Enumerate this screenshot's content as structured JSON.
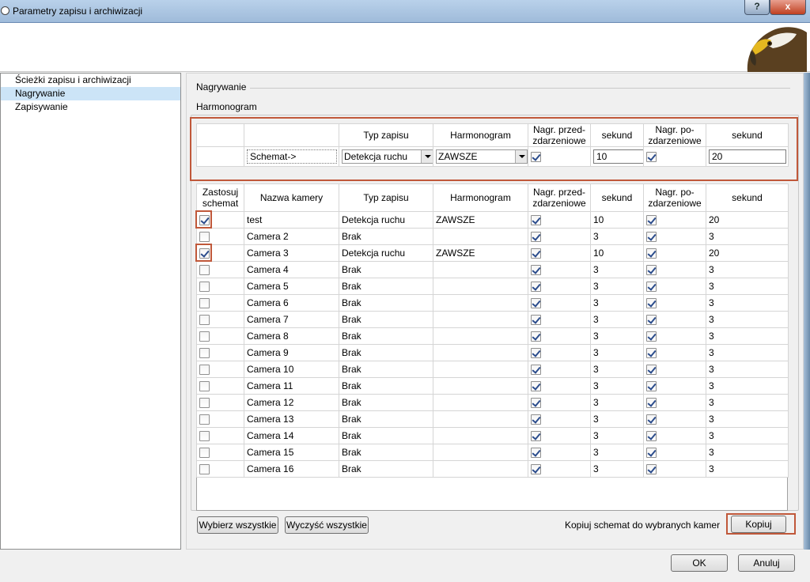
{
  "window": {
    "title": "Parametry zapisu i archiwizacji",
    "help_label": "?",
    "close_label": "x"
  },
  "sidebar": {
    "items": [
      {
        "label": "Ścieżki zapisu i archiwizacji"
      },
      {
        "label": "Nagrywanie"
      },
      {
        "label": "Zapisywanie"
      }
    ]
  },
  "section": {
    "title": "Nagrywanie",
    "subtitle": "Harmonogram"
  },
  "schema_table": {
    "headers": [
      "",
      "",
      "Typ zapisu",
      "Harmonogram",
      "Nagr. przed-\nzdarzeniowe",
      "sekund",
      "Nagr. po-\nzdarzeniowe",
      "sekund"
    ],
    "row": {
      "label": "Schemat->",
      "type": "Detekcja ruchu",
      "schedule": "ZAWSZE",
      "pre_checked": true,
      "pre_seconds": "10",
      "post_checked": true,
      "post_seconds": "20"
    }
  },
  "camera_table": {
    "headers": [
      "Zastosuj\nschemat",
      "Nazwa kamery",
      "Typ zapisu",
      "Harmonogram",
      "Nagr. przed-\nzdarzeniowe",
      "sekund",
      "Nagr. po-\nzdarzeniowe",
      "sekund"
    ],
    "rows": [
      {
        "apply": true,
        "name": "test",
        "type": "Detekcja ruchu",
        "schedule": "ZAWSZE",
        "pre": true,
        "pre_s": "10",
        "post": true,
        "post_s": "20"
      },
      {
        "apply": false,
        "name": "Camera 2",
        "type": "Brak",
        "schedule": "",
        "pre": true,
        "pre_s": "3",
        "post": true,
        "post_s": "3"
      },
      {
        "apply": true,
        "name": "Camera 3",
        "type": "Detekcja ruchu",
        "schedule": "ZAWSZE",
        "pre": true,
        "pre_s": "10",
        "post": true,
        "post_s": "20"
      },
      {
        "apply": false,
        "name": "Camera 4",
        "type": "Brak",
        "schedule": "",
        "pre": true,
        "pre_s": "3",
        "post": true,
        "post_s": "3"
      },
      {
        "apply": false,
        "name": "Camera 5",
        "type": "Brak",
        "schedule": "",
        "pre": true,
        "pre_s": "3",
        "post": true,
        "post_s": "3"
      },
      {
        "apply": false,
        "name": "Camera 6",
        "type": "Brak",
        "schedule": "",
        "pre": true,
        "pre_s": "3",
        "post": true,
        "post_s": "3"
      },
      {
        "apply": false,
        "name": "Camera 7",
        "type": "Brak",
        "schedule": "",
        "pre": true,
        "pre_s": "3",
        "post": true,
        "post_s": "3"
      },
      {
        "apply": false,
        "name": "Camera 8",
        "type": "Brak",
        "schedule": "",
        "pre": true,
        "pre_s": "3",
        "post": true,
        "post_s": "3"
      },
      {
        "apply": false,
        "name": "Camera 9",
        "type": "Brak",
        "schedule": "",
        "pre": true,
        "pre_s": "3",
        "post": true,
        "post_s": "3"
      },
      {
        "apply": false,
        "name": "Camera 10",
        "type": "Brak",
        "schedule": "",
        "pre": true,
        "pre_s": "3",
        "post": true,
        "post_s": "3"
      },
      {
        "apply": false,
        "name": "Camera 11",
        "type": "Brak",
        "schedule": "",
        "pre": true,
        "pre_s": "3",
        "post": true,
        "post_s": "3"
      },
      {
        "apply": false,
        "name": "Camera 12",
        "type": "Brak",
        "schedule": "",
        "pre": true,
        "pre_s": "3",
        "post": true,
        "post_s": "3"
      },
      {
        "apply": false,
        "name": "Camera 13",
        "type": "Brak",
        "schedule": "",
        "pre": true,
        "pre_s": "3",
        "post": true,
        "post_s": "3"
      },
      {
        "apply": false,
        "name": "Camera 14",
        "type": "Brak",
        "schedule": "",
        "pre": true,
        "pre_s": "3",
        "post": true,
        "post_s": "3"
      },
      {
        "apply": false,
        "name": "Camera 15",
        "type": "Brak",
        "schedule": "",
        "pre": true,
        "pre_s": "3",
        "post": true,
        "post_s": "3"
      },
      {
        "apply": false,
        "name": "Camera 16",
        "type": "Brak",
        "schedule": "",
        "pre": true,
        "pre_s": "3",
        "post": true,
        "post_s": "3"
      }
    ]
  },
  "actions": {
    "select_all": "Wybierz wszystkie",
    "clear_all": "Wyczyść wszystkie",
    "copy_caption": "Kopiuj schemat do wybranych kamer",
    "copy_button": "Kopiuj",
    "ok": "OK",
    "cancel": "Anuluj"
  },
  "colors": {
    "highlight": "#c0583a",
    "selection": "#cce4f7"
  }
}
